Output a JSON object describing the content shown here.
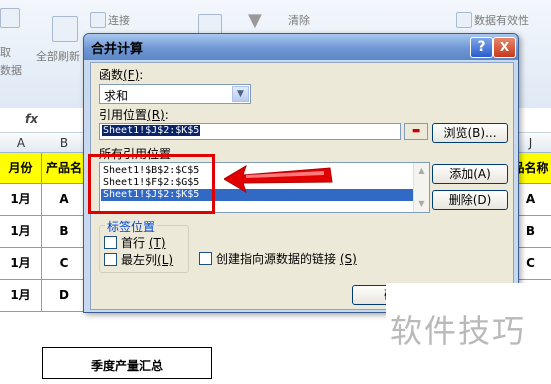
{
  "ribbon": {
    "get_data_label_1": "取",
    "get_data_label_2": "数据",
    "refresh_all_label": "全部刷新",
    "connections_label": "连接",
    "clear_label": "清除",
    "data_validation_label": "数据有效性",
    "formula_bar_label": "fx"
  },
  "sheet": {
    "columns": [
      "A",
      "B",
      "J"
    ],
    "header_row": {
      "month": "月份",
      "product": "产品名",
      "product_right": "品名称"
    },
    "rows": [
      {
        "month": "1月",
        "product": "A",
        "right": "A"
      },
      {
        "month": "1月",
        "product": "B",
        "right": "B"
      },
      {
        "month": "1月",
        "product": "C",
        "right": "C"
      },
      {
        "month": "1月",
        "product": "D",
        "right": "D"
      }
    ],
    "summary_title": "季度产量汇总"
  },
  "dialog": {
    "title": "合并计算",
    "help_button": "?",
    "close_button": "X",
    "function_label": "函数",
    "function_hotkey": "(F)",
    "function_value": "求和",
    "reference_label": "引用位置",
    "reference_hotkey": "(R)",
    "reference_value": "Sheet1!$J$2:$K$5",
    "browse_button": "浏览(B)...",
    "all_references_label": "所有引用位置",
    "references": [
      "Sheet1!$B$2:$C$5",
      "Sheet1!$F$2:$G$5",
      "Sheet1!$J$2:$K$5"
    ],
    "add_button": "添加(A)",
    "delete_button": "删除(D)",
    "label_position_title": "标签位置",
    "first_row_label": "首行",
    "first_row_hotkey": "(T)",
    "left_column_label": "最左列",
    "left_column_hotkey": "(L)",
    "create_links_label": "创建指向源数据的链接",
    "create_links_hotkey": "(S)",
    "ok_button": "确"
  },
  "watermark": "软件技巧",
  "colors": {
    "header_fill": "#ffff00",
    "annotation_red": "#e00000",
    "selection_blue": "#316ac5"
  }
}
